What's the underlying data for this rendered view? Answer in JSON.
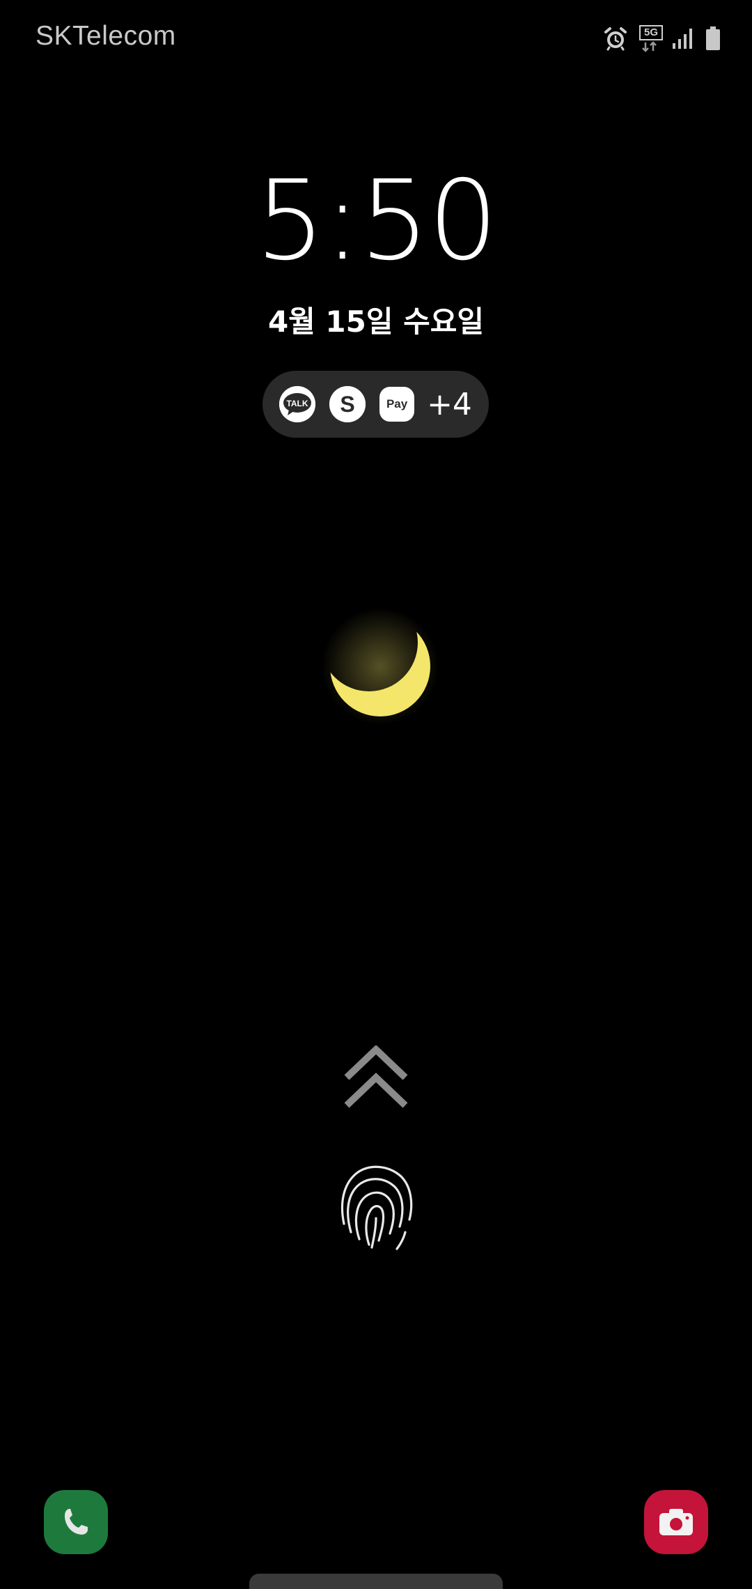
{
  "status_bar": {
    "carrier": "SKTelecom",
    "network_type": "5G",
    "icons": [
      "alarm-icon",
      "network-5g-icon",
      "signal-icon",
      "battery-icon"
    ]
  },
  "lock_screen": {
    "time": "5:50",
    "date": "4월 15일 수요일",
    "notifications": {
      "apps": [
        {
          "name": "kakaotalk-icon",
          "label": "TALK"
        },
        {
          "name": "s-app-icon",
          "label": "S"
        },
        {
          "name": "pay-icon",
          "label": "Pay"
        }
      ],
      "more_count": "+4"
    },
    "wallpaper": "crescent-moon",
    "shortcuts": {
      "left": "phone-icon",
      "right": "camera-icon"
    }
  },
  "colors": {
    "background": "#000000",
    "moon": "#f3e66a",
    "phone_shortcut": "#1e7a3c",
    "camera_shortcut": "#c4143a",
    "notification_pill": "#2a2a2a"
  }
}
